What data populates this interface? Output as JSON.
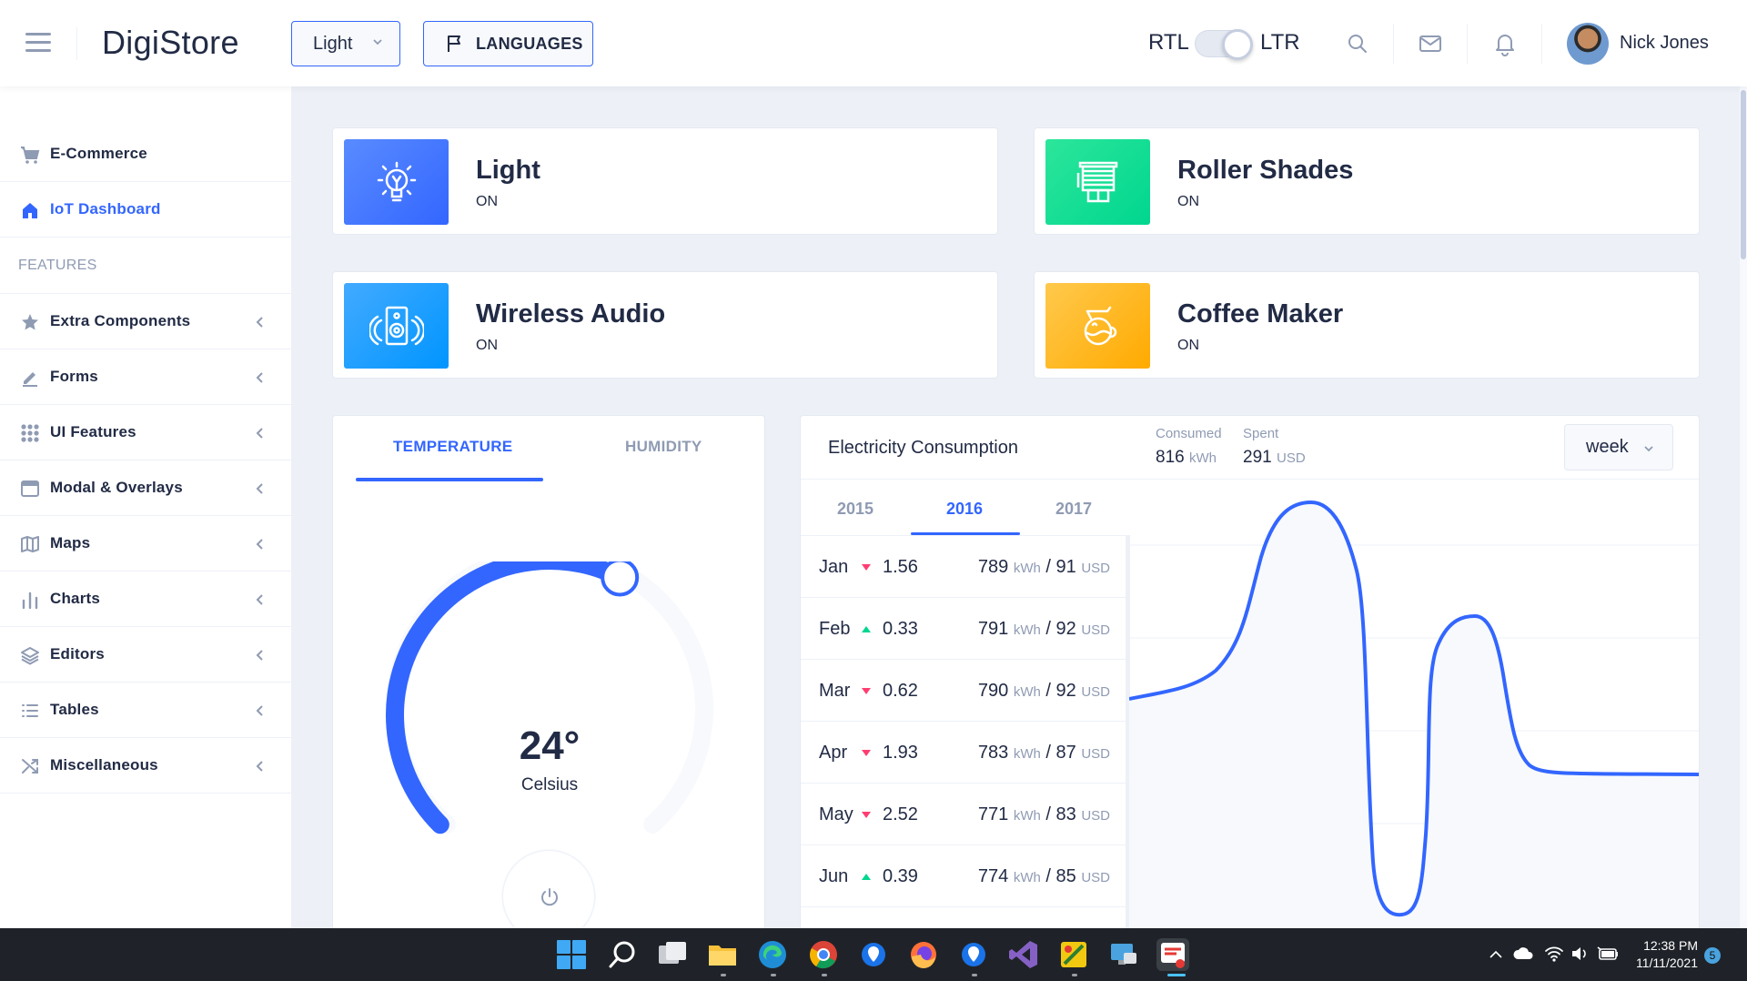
{
  "header": {
    "brand": "DigiStore",
    "theme_select": "Light",
    "languages_label": "LANGUAGES",
    "rtl_label": "RTL",
    "ltr_label": "LTR",
    "user_name": "Nick Jones"
  },
  "sidebar": {
    "items_top": [
      {
        "label": "E-Commerce",
        "icon": "cart-icon"
      },
      {
        "label": "IoT Dashboard",
        "icon": "home-icon",
        "active": true
      }
    ],
    "group_label": "FEATURES",
    "items": [
      {
        "label": "Extra Components",
        "icon": "star-icon"
      },
      {
        "label": "Forms",
        "icon": "edit-icon"
      },
      {
        "label": "UI Features",
        "icon": "grid-icon"
      },
      {
        "label": "Modal & Overlays",
        "icon": "browser-icon"
      },
      {
        "label": "Maps",
        "icon": "map-icon"
      },
      {
        "label": "Charts",
        "icon": "bar-chart-icon"
      },
      {
        "label": "Editors",
        "icon": "layers-icon"
      },
      {
        "label": "Tables",
        "icon": "list-icon"
      },
      {
        "label": "Miscellaneous",
        "icon": "shuffle-icon"
      }
    ]
  },
  "devices": [
    {
      "title": "Light",
      "status": "ON",
      "icon": "bulb-icon",
      "color": "#3366ff"
    },
    {
      "title": "Roller Shades",
      "status": "ON",
      "icon": "shades-icon",
      "color": "#00d68f"
    },
    {
      "title": "Wireless Audio",
      "status": "ON",
      "icon": "speaker-icon",
      "color": "#0095ff"
    },
    {
      "title": "Coffee Maker",
      "status": "ON",
      "icon": "coffee-icon",
      "color": "#ffaa00"
    }
  ],
  "temperature": {
    "tabs": [
      "TEMPERATURE",
      "HUMIDITY"
    ],
    "value": "24°",
    "unit": "Celsius",
    "dial_fraction": 0.6
  },
  "electricity": {
    "title": "Electricity Consumption",
    "consumed_label": "Consumed",
    "consumed_value": "816",
    "consumed_unit": "kWh",
    "spent_label": "Spent",
    "spent_value": "291",
    "spent_unit": "USD",
    "period_select": "week",
    "years": [
      "2015",
      "2016",
      "2017"
    ],
    "active_year": "2016",
    "rows": [
      {
        "month": "Jan",
        "delta": "1.56",
        "trend": "down",
        "kwh": "789",
        "usd": "91"
      },
      {
        "month": "Feb",
        "delta": "0.33",
        "trend": "up",
        "kwh": "791",
        "usd": "92"
      },
      {
        "month": "Mar",
        "delta": "0.62",
        "trend": "down",
        "kwh": "790",
        "usd": "92"
      },
      {
        "month": "Apr",
        "delta": "1.93",
        "trend": "down",
        "kwh": "783",
        "usd": "87"
      },
      {
        "month": "May",
        "delta": "2.52",
        "trend": "down",
        "kwh": "771",
        "usd": "83"
      },
      {
        "month": "Jun",
        "delta": "0.39",
        "trend": "up",
        "kwh": "774",
        "usd": "85"
      }
    ],
    "kwh_unit": "kWh",
    "usd_unit": "USD",
    "colors": {
      "up": "#00d68f",
      "down": "#ff3d71",
      "line": "#3366ff"
    }
  },
  "taskbar": {
    "time": "12:38 PM",
    "date": "11/11/2021",
    "badge": "5"
  }
}
